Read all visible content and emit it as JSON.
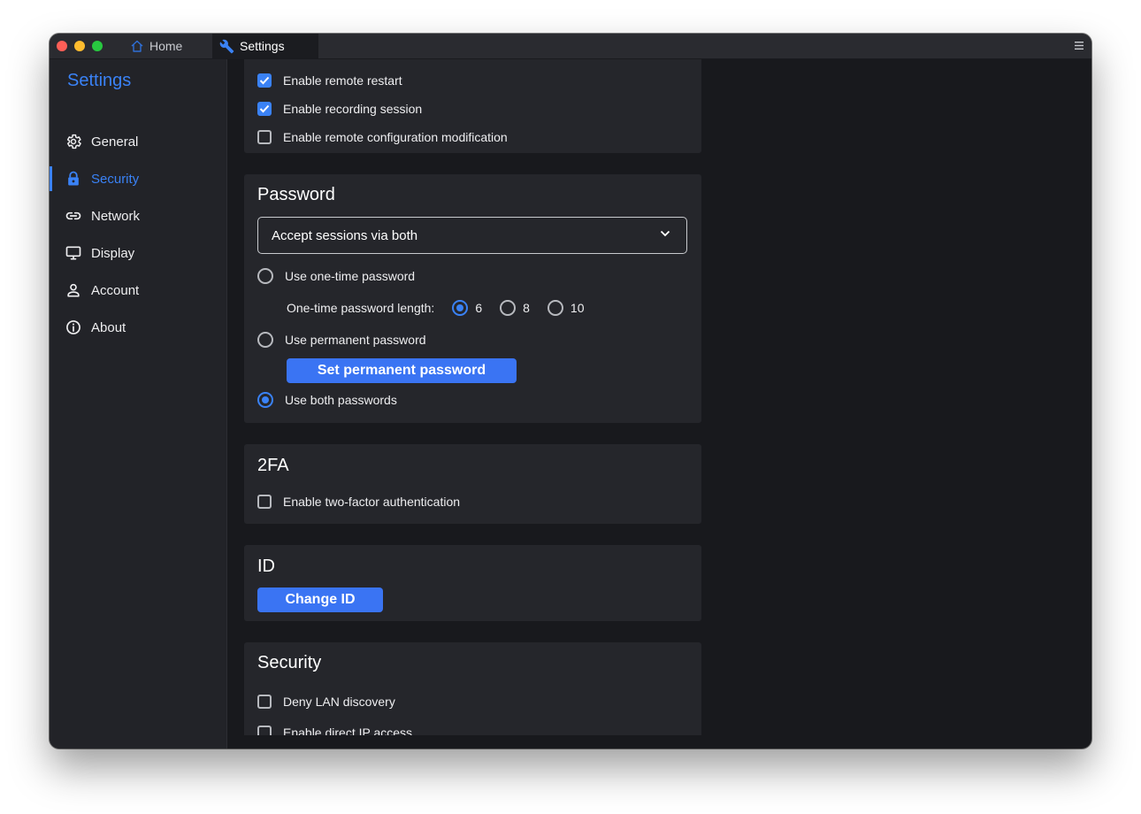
{
  "tabs": {
    "home": "Home",
    "settings": "Settings"
  },
  "sidebar": {
    "title": "Settings",
    "items": [
      {
        "label": "General",
        "icon": "gear-icon"
      },
      {
        "label": "Security",
        "icon": "lock-icon",
        "active": true
      },
      {
        "label": "Network",
        "icon": "link-icon"
      },
      {
        "label": "Display",
        "icon": "monitor-icon"
      },
      {
        "label": "Account",
        "icon": "person-icon"
      },
      {
        "label": "About",
        "icon": "info-icon"
      }
    ]
  },
  "permissions": {
    "remote_restart": {
      "label": "Enable remote restart",
      "checked": true
    },
    "recording_session": {
      "label": "Enable recording session",
      "checked": true
    },
    "remote_config": {
      "label": "Enable remote configuration modification",
      "checked": false
    }
  },
  "password": {
    "title": "Password",
    "accept_select": "Accept sessions via both",
    "one_time": {
      "label": "Use one-time password",
      "selected": false
    },
    "length_label": "One-time password length:",
    "length_options": [
      "6",
      "8",
      "10"
    ],
    "length_selected": "6",
    "permanent": {
      "label": "Use permanent password",
      "selected": false
    },
    "set_permanent_button": "Set permanent password",
    "both": {
      "label": "Use both passwords",
      "selected": true
    }
  },
  "twofa": {
    "title": "2FA",
    "enable": {
      "label": "Enable two-factor authentication",
      "checked": false
    }
  },
  "id_section": {
    "title": "ID",
    "change_button": "Change ID"
  },
  "security_section": {
    "title": "Security",
    "deny_lan": {
      "label": "Deny LAN discovery",
      "checked": false
    },
    "direct_ip": {
      "label": "Enable direct IP access",
      "checked": false
    }
  },
  "colors": {
    "accent": "#3a82f6",
    "window_bg": "#18191d",
    "card_bg": "#25262b",
    "sidebar_bg": "#222328"
  }
}
